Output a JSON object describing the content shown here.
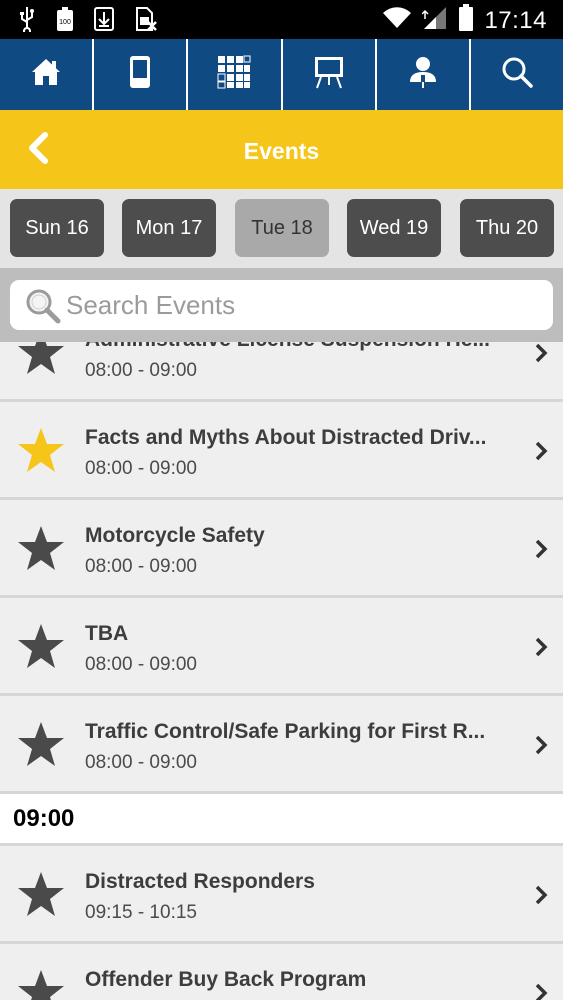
{
  "status_bar": {
    "time": "17:14",
    "battery_text": "100",
    "icons": [
      "usb-icon",
      "battery-saver-icon",
      "download-icon",
      "no-sim-icon",
      "wifi-icon",
      "signal-icon",
      "battery-icon"
    ]
  },
  "top_nav": {
    "items": [
      {
        "icon": "home-icon"
      },
      {
        "icon": "mobile-device-icon"
      },
      {
        "icon": "floorplan-grid-icon"
      },
      {
        "icon": "presentation-easel-icon"
      },
      {
        "icon": "speaker-icon"
      },
      {
        "icon": "search-icon"
      }
    ]
  },
  "header": {
    "title": "Events",
    "back_icon": "chevron-left-icon"
  },
  "days": [
    {
      "label": "Sun 16",
      "active": false
    },
    {
      "label": "Mon 17",
      "active": false
    },
    {
      "label": "Tue 18",
      "active": true
    },
    {
      "label": "Wed 19",
      "active": false
    },
    {
      "label": "Thu 20",
      "active": false
    }
  ],
  "search": {
    "placeholder": "Search Events",
    "value": ""
  },
  "colors": {
    "nav_bg": "#0f4a83",
    "header_bg": "#f6c51a",
    "star_on": "#f6c51a",
    "star_off": "#4a4a4a",
    "day_bg": "#4d4d4d",
    "day_active_bg": "#a9a9a9"
  },
  "events": [
    {
      "title": "Administrative License Suspension He...",
      "time": "08:00 - 09:00",
      "starred": false
    },
    {
      "title": "Facts and Myths About Distracted Driv...",
      "time": "08:00 - 09:00",
      "starred": true
    },
    {
      "title": "Motorcycle Safety",
      "time": "08:00 - 09:00",
      "starred": false
    },
    {
      "title": "TBA",
      "time": "08:00 - 09:00",
      "starred": false
    },
    {
      "title": "Traffic Control/Safe Parking for First R...",
      "time": "08:00 - 09:00",
      "starred": false
    }
  ],
  "section_0900": {
    "label": "09:00"
  },
  "events_0900": [
    {
      "title": "Distracted Responders",
      "time": "09:15 - 10:15",
      "starred": false
    },
    {
      "title": "Offender Buy Back Program",
      "time": "",
      "starred": false
    }
  ]
}
